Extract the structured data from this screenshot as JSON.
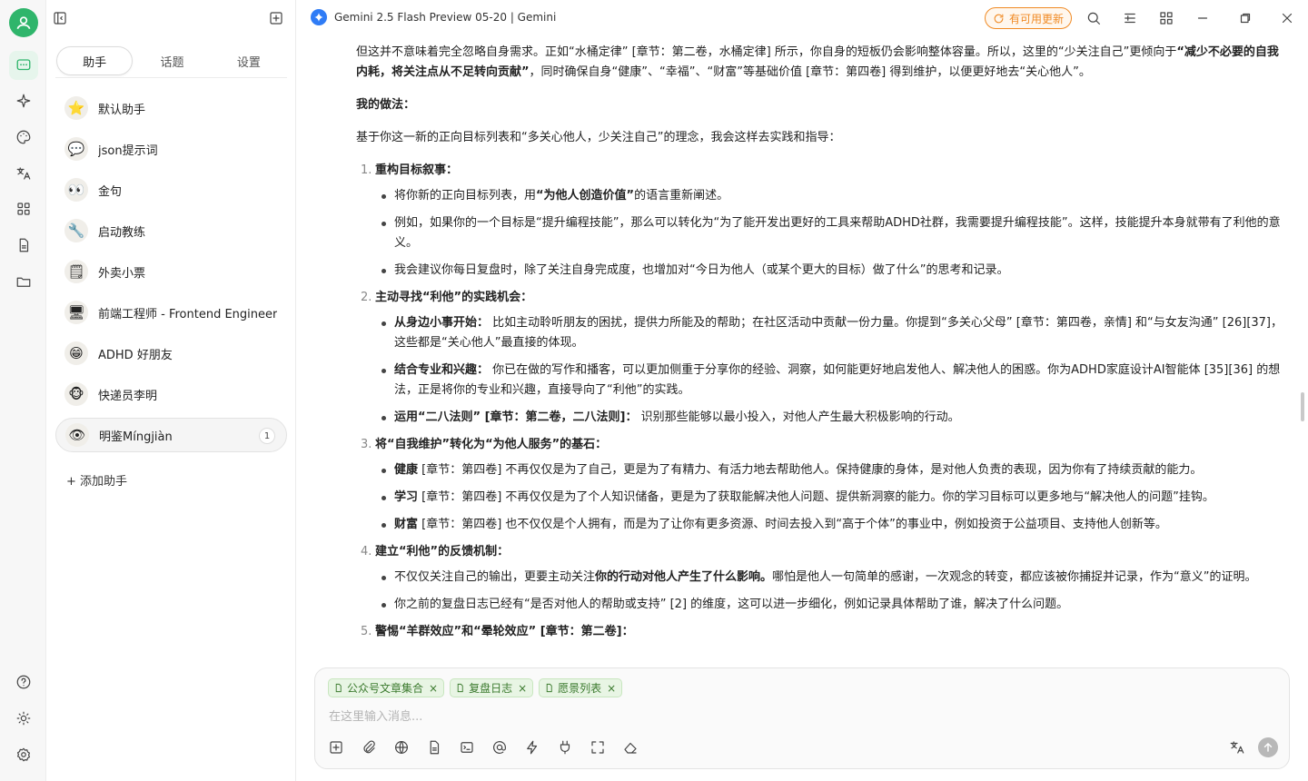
{
  "app": {
    "title": "Gemini 2.5 Flash Preview 05-20 | Gemini",
    "update_label": "有可用更新"
  },
  "panel": {
    "tabs": [
      "助手",
      "话题",
      "设置"
    ],
    "active_tab": 0,
    "assistants": [
      {
        "emoji": "⭐",
        "name": "默认助手"
      },
      {
        "emoji": "💬",
        "name": "json提示词"
      },
      {
        "emoji": "👀",
        "name": "金句"
      },
      {
        "emoji": "🔧",
        "name": "启动教练"
      },
      {
        "emoji": "🗒",
        "name": "外卖小票"
      },
      {
        "emoji": "🖥",
        "name": "前端工程师 - Frontend Engineer"
      },
      {
        "emoji": "😁",
        "name": "ADHD 好朋友"
      },
      {
        "emoji": "🐵",
        "name": "快递员李明"
      },
      {
        "emoji": "👁",
        "name": "明鉴Míngjiàn",
        "badge": "1",
        "active": true
      }
    ],
    "add_label": "+ 添加助手"
  },
  "message": {
    "para1_a": "但这并不意味着完全忽略自身需求。正如“水桶定律” [章节：第二卷，水桶定律] 所示，你自身的短板仍会影响整体容量。所以，这里的“少关注自己”更倾向于",
    "para1_b": "“减少不必要的自我内耗，将关注点从不足转向贡献”",
    "para1_c": "，同时确保自身“健康”、“幸福”、“财富”等基础价值 [章节：第四卷] 得到维护，以便更好地去“关心他人”。",
    "heading": "我的做法：",
    "intro": "基于你这一新的正向目标列表和“多关心他人，少关注自己”的理念，我会这样去实践和指导：",
    "steps": [
      {
        "num": "1.",
        "title": "重构目标叙事：",
        "items": [
          {
            "pre": "将你新的正向目标列表，用",
            "bold": "“为他人创造价值”",
            "post": "的语言重新阐述。"
          },
          {
            "pre": "例如，如果你的一个目标是“提升编程技能”，那么可以转化为“为了能开发出更好的工具来帮助ADHD社群，我需要提升编程技能”。这样，技能提升本身就带有了利他的意义。",
            "bold": "",
            "post": ""
          },
          {
            "pre": "我会建议你每日复盘时，除了关注自身完成度，也增加对“今日为他人（或某个更大的目标）做了什么”的思考和记录。",
            "bold": "",
            "post": ""
          }
        ]
      },
      {
        "num": "2.",
        "title": "主动寻找“利他”的实践机会：",
        "items": [
          {
            "pre": "",
            "bold": "从身边小事开始：",
            "post": " 比如主动聆听朋友的困扰，提供力所能及的帮助；在社区活动中贡献一份力量。你提到“多关心父母” [章节：第四卷，亲情] 和“与女友沟通” [26][37]，这些都是“关心他人”最直接的体现。"
          },
          {
            "pre": "",
            "bold": "结合专业和兴趣：",
            "post": " 你已在做的写作和播客，可以更加侧重于分享你的经验、洞察，如何能更好地启发他人、解决他人的困惑。你为ADHD家庭设计AI智能体 [35][36] 的想法，正是将你的专业和兴趣，直接导向了“利他”的实践。"
          },
          {
            "pre": "",
            "bold": "运用“二八法则” [章节：第二卷，二八法则]：",
            "post": " 识别那些能够以最小投入，对他人产生最大积极影响的行动。"
          }
        ]
      },
      {
        "num": "3.",
        "title": "将“自我维护”转化为“为他人服务”的基石：",
        "items": [
          {
            "pre": "",
            "bold": "健康",
            "post": " [章节：第四卷] 不再仅仅是为了自己，更是为了有精力、有活力地去帮助他人。保持健康的身体，是对他人负责的表现，因为你有了持续贡献的能力。"
          },
          {
            "pre": "",
            "bold": "学习",
            "post": " [章节：第四卷] 不再仅仅是为了个人知识储备，更是为了获取能解决他人问题、提供新洞察的能力。你的学习目标可以更多地与“解决他人的问题”挂钩。"
          },
          {
            "pre": "",
            "bold": "财富",
            "post": " [章节：第四卷] 也不仅仅是个人拥有，而是为了让你有更多资源、时间去投入到“高于个体”的事业中，例如投资于公益项目、支持他人创新等。"
          }
        ]
      },
      {
        "num": "4.",
        "title": "建立“利他”的反馈机制：",
        "items": [
          {
            "pre": "不仅仅关注自己的输出，更要主动关注",
            "bold": "你的行动对他人产生了什么影响。",
            "post": "哪怕是他人一句简单的感谢，一次观念的转变，都应该被你捕捉并记录，作为“意义”的证明。"
          },
          {
            "pre": "你之前的复盘日志已经有“是否对他人的帮助或支持” [2] 的维度，这可以进一步细化，例如记录具体帮助了谁，解决了什么问题。",
            "bold": "",
            "post": ""
          }
        ]
      },
      {
        "num": "5.",
        "title": "警惕“羊群效应”和“晕轮效应” [章节：第二卷]：",
        "items": []
      }
    ]
  },
  "composer": {
    "chips": [
      "公众号文章集合",
      "复盘日志",
      "愿景列表"
    ],
    "placeholder": "在这里输入消息..."
  }
}
